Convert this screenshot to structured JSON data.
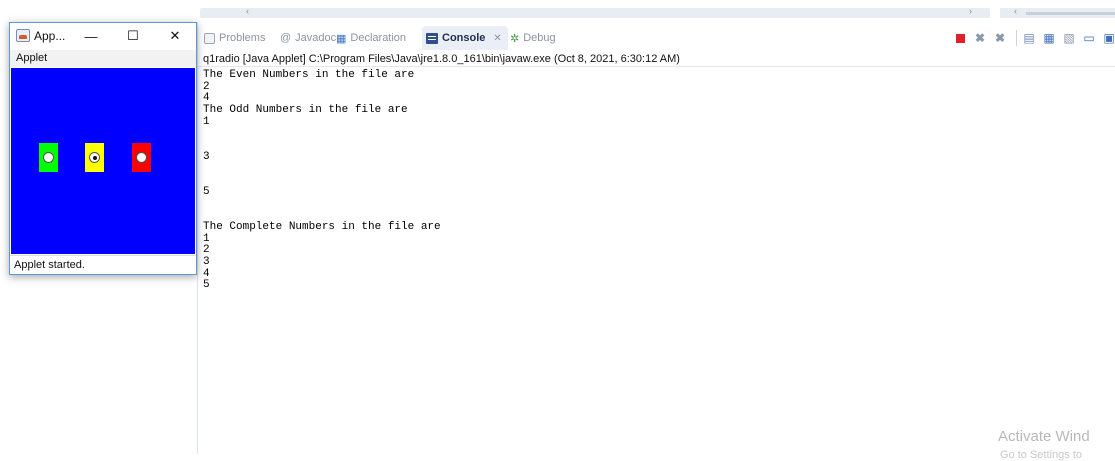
{
  "ide": {
    "tabs": [
      {
        "label": "Problems",
        "icon": "problems-icon"
      },
      {
        "label": "Javadoc",
        "icon": "javadoc-icon",
        "glyph": "@"
      },
      {
        "label": "Declaration",
        "icon": "declaration-icon"
      },
      {
        "label": "Console",
        "icon": "console-icon",
        "close": "✕",
        "active": true
      },
      {
        "label": "Debug",
        "icon": "debug-icon"
      }
    ],
    "launch_info": "q1radio [Java Applet] C:\\Program Files\\Java\\jre1.8.0_161\\bin\\javaw.exe (Oct 8, 2021, 6:30:12 AM)",
    "console_lines": [
      "The Even Numbers in the file are",
      "2",
      "4",
      "The Odd Numbers in the file are",
      "1",
      "",
      "",
      "3",
      "",
      "",
      "5",
      "",
      "",
      "The Complete Numbers in the file are",
      "1",
      "2",
      "3",
      "4",
      "5"
    ],
    "watermark": "Activate Wind",
    "watermark_sub": "Go to Settings to"
  },
  "applet": {
    "window_title": "App...",
    "minimize_glyph": "—",
    "maximize_glyph": "☐",
    "close_glyph": "✕",
    "menu_label": "Applet",
    "status": "Applet started.",
    "canvas_color": "#0000ff",
    "radios": [
      {
        "color": "#00ff00",
        "checked": false
      },
      {
        "color": "#ffff00",
        "checked": true
      },
      {
        "color": "#ff0000",
        "checked": false
      }
    ]
  }
}
